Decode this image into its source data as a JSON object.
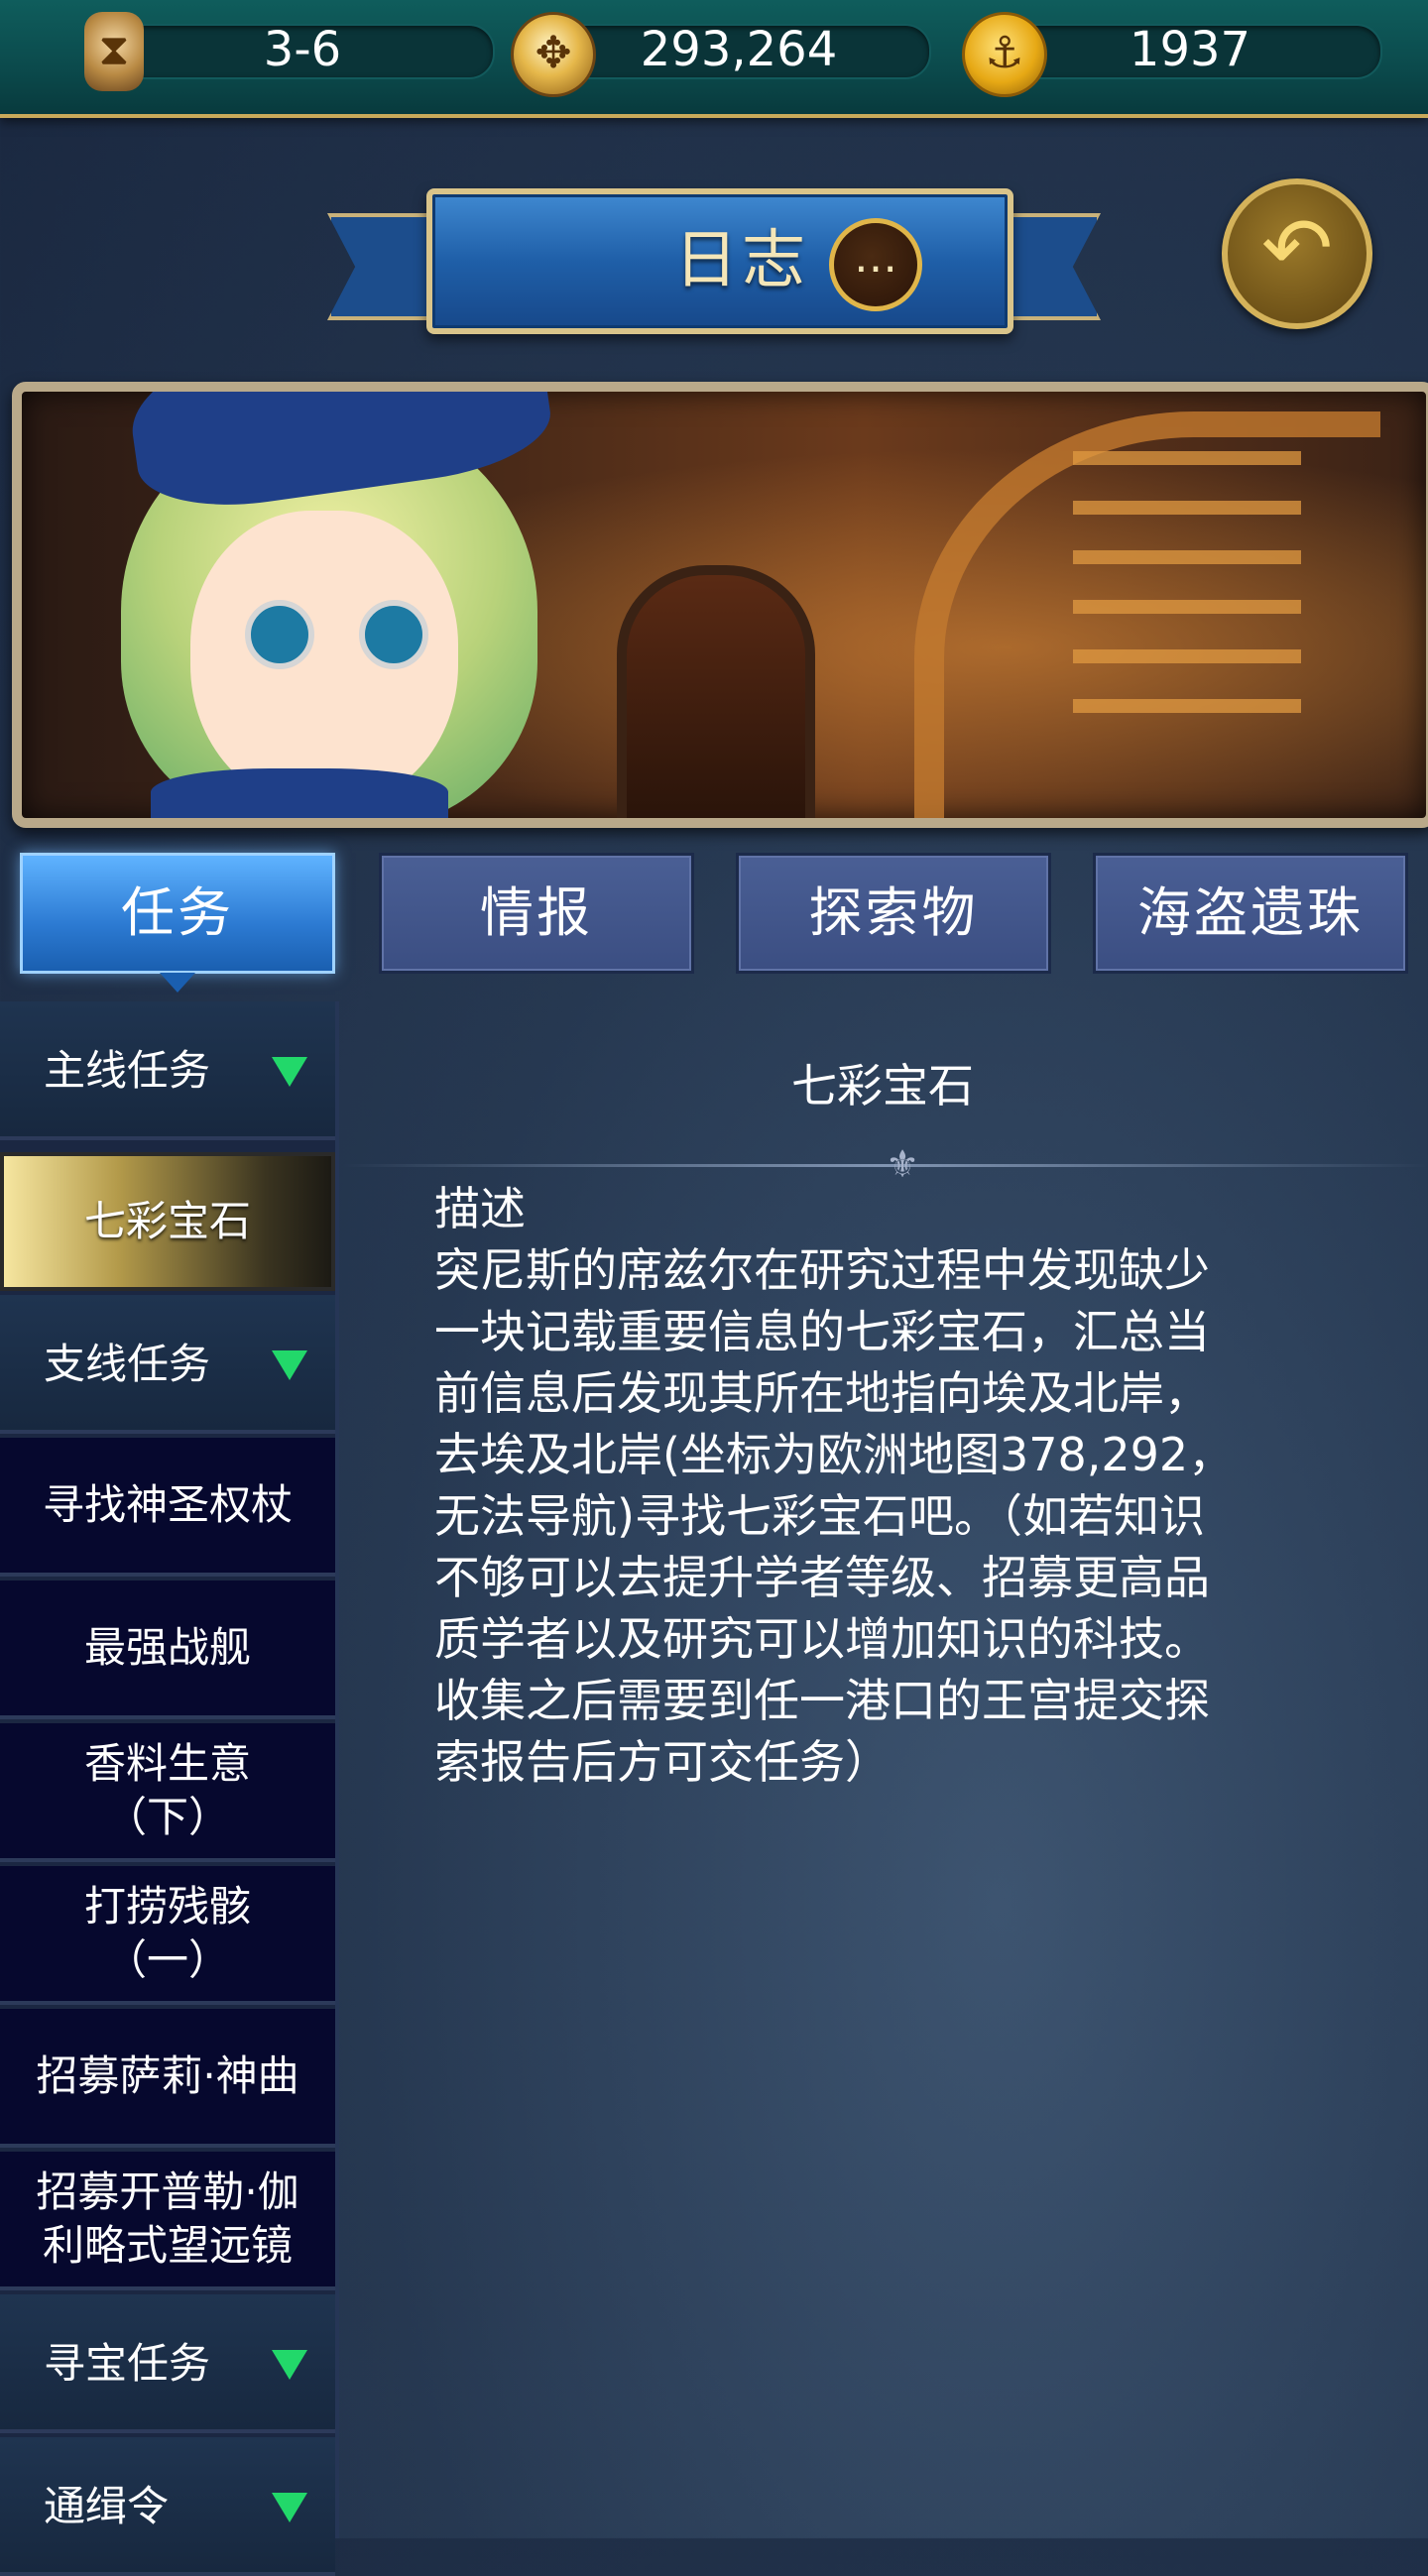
{
  "resources": [
    {
      "icon": "hourglass-icon",
      "value": "3-6"
    },
    {
      "icon": "compass-icon",
      "value": "293,264"
    },
    {
      "icon": "anchor-coin-icon",
      "value": "1937"
    }
  ],
  "header": {
    "title": "日志"
  },
  "tabs": [
    "任务",
    "情报",
    "探索物",
    "海盗遗珠"
  ],
  "active_tab": "任务",
  "list": [
    {
      "type": "category",
      "label": "主线任务"
    },
    {
      "type": "selected",
      "label": "七彩宝石"
    },
    {
      "type": "category",
      "label": "支线任务"
    },
    {
      "type": "task",
      "label": "寻找神圣权杖"
    },
    {
      "type": "task",
      "label": "最强战舰"
    },
    {
      "type": "task",
      "line1": "香料生意",
      "line2": "（下）"
    },
    {
      "type": "task",
      "line1": "打捞残骸",
      "line2": "（一）"
    },
    {
      "type": "task",
      "label": "招募萨莉·神曲"
    },
    {
      "type": "task",
      "line1": "招募开普勒·伽",
      "line2": "利略式望远镜"
    },
    {
      "type": "category",
      "label": "寻宝任务"
    },
    {
      "type": "category",
      "label": "通缉令"
    }
  ],
  "detail": {
    "title": "七彩宝石",
    "label": "描述",
    "body": "突尼斯的席兹尔在研究过程中发现缺少\n一块记载重要信息的七彩宝石，汇总当\n前信息后发现其所在地指向埃及北岸，\n去埃及北岸(坐标为欧洲地图378,292，\n无法导航)寻找七彩宝石吧。（如若知识\n不够可以去提升学者等级、招募更高品\n质学者以及研究可以增加知识的科技。\n收集之后需要到任一港口的王宫提交探\n索报告后方可交任务）"
  }
}
